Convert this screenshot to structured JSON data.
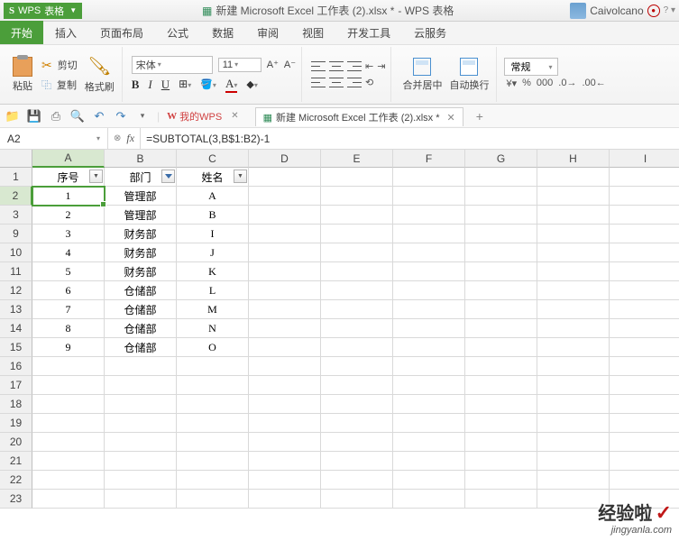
{
  "title": {
    "app_prefix": "WPS",
    "app_name": "表格",
    "file": "新建 Microsoft Excel 工作表 (2).xlsx *",
    "suffix": "- WPS 表格",
    "user": "Caivolcano"
  },
  "menu": {
    "home": "开始",
    "items": [
      "插入",
      "页面布局",
      "公式",
      "数据",
      "审阅",
      "视图",
      "开发工具",
      "云服务"
    ]
  },
  "ribbon": {
    "paste": "粘贴",
    "cut": "剪切",
    "copy": "复制",
    "format_painter": "格式刷",
    "font": "宋体",
    "font_size": "11",
    "merge": "合并居中",
    "wrap": "自动换行",
    "number_format": "常规"
  },
  "qat": {
    "my_wps": "我的WPS",
    "file_tab": "新建 Microsoft Excel 工作表 (2).xlsx *"
  },
  "formula_bar": {
    "cell_ref": "A2",
    "formula": "=SUBTOTAL(3,B$1:B2)-1"
  },
  "columns": [
    "A",
    "B",
    "C",
    "D",
    "E",
    "F",
    "G",
    "H",
    "I"
  ],
  "header_row": {
    "num": "1",
    "a": "序号",
    "b": "部门",
    "c": "姓名"
  },
  "data_rows": [
    {
      "num": "2",
      "a": "1",
      "b": "管理部",
      "c": "A"
    },
    {
      "num": "3",
      "a": "2",
      "b": "管理部",
      "c": "B"
    },
    {
      "num": "9",
      "a": "3",
      "b": "财务部",
      "c": "I"
    },
    {
      "num": "10",
      "a": "4",
      "b": "财务部",
      "c": "J"
    },
    {
      "num": "11",
      "a": "5",
      "b": "财务部",
      "c": "K"
    },
    {
      "num": "12",
      "a": "6",
      "b": "仓储部",
      "c": "L"
    },
    {
      "num": "13",
      "a": "7",
      "b": "仓储部",
      "c": "M"
    },
    {
      "num": "14",
      "a": "8",
      "b": "仓储部",
      "c": "N"
    },
    {
      "num": "15",
      "a": "9",
      "b": "仓储部",
      "c": "O"
    }
  ],
  "empty_rows": [
    "16",
    "17",
    "18",
    "19",
    "20",
    "21",
    "22",
    "23"
  ],
  "watermark": {
    "brand": "经验啦",
    "check": "✓",
    "url": "jingyanla.com"
  }
}
